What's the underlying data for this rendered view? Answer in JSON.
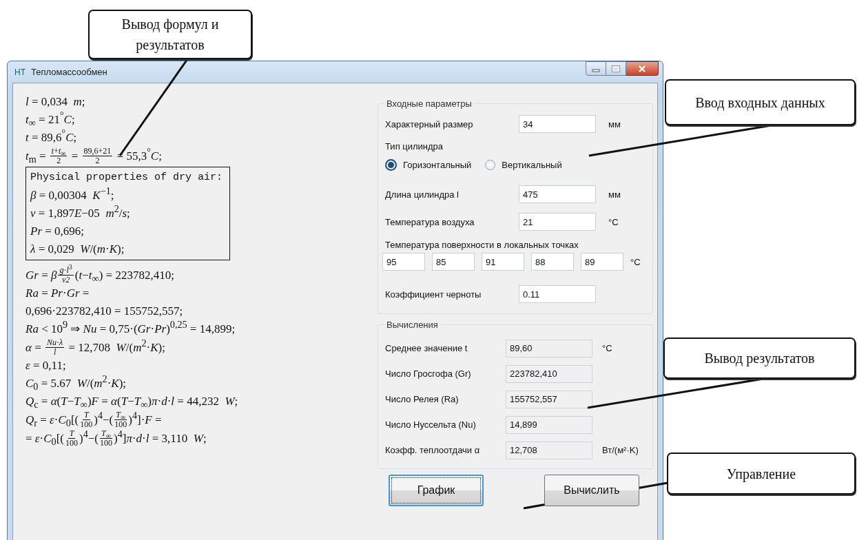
{
  "window": {
    "icon_text": "НТ",
    "title": "Тепломассообмен"
  },
  "formulas": {
    "lines_before": [
      {
        "parts": [
          {
            "kind": "text",
            "text": "*l* = 0,034  *m*;"
          }
        ]
      },
      {
        "parts": [
          {
            "kind": "text",
            "text": "*t*$_{∞}$ = 21$^{°}$*C*;"
          }
        ]
      },
      {
        "parts": [
          {
            "kind": "text",
            "text": "*t* = 89,6$^{°}$*C*;"
          }
        ]
      },
      {
        "parts": [
          {
            "kind": "text",
            "text": "*t*$_{m}$ = "
          },
          {
            "kind": "frac",
            "num": "*t*+*t*$_{∞}$",
            "den": "2"
          },
          {
            "kind": "text",
            "text": " = "
          },
          {
            "kind": "frac",
            "num": "89,6+21",
            "den": "2"
          },
          {
            "kind": "text",
            "text": " = 55,3$^{°}$*C*;"
          }
        ]
      }
    ],
    "properties_box": {
      "title": "Physical properties of dry air:",
      "lines": [
        {
          "parts": [
            {
              "kind": "text",
              "text": "*β* = 0,00304  *K*$^{−1}$;"
            }
          ]
        },
        {
          "parts": [
            {
              "kind": "text",
              "text": "*ν* = 1,897"
            },
            {
              "kind": "text",
              "text": "*E*−05  *m*$^{2}$/*s*;"
            }
          ]
        },
        {
          "parts": [
            {
              "kind": "text",
              "text": "*Pr* = 0,696;"
            }
          ]
        },
        {
          "parts": [
            {
              "kind": "text",
              "text": "*λ* = 0,029  *W*/(*m*·*K*);"
            }
          ]
        }
      ]
    },
    "lines_after": [
      {
        "parts": [
          {
            "kind": "text",
            "text": "*Gr* = *β*"
          },
          {
            "kind": "frac",
            "num": "*g*·*l*$^{3}$",
            "den": "*ν2*"
          },
          {
            "kind": "text",
            "text": "(*t*−*t*$_{∞}$) = 223782,410;"
          }
        ]
      },
      {
        "parts": [
          {
            "kind": "text",
            "text": "*Ra* = *Pr*·*Gr* ="
          }
        ]
      },
      {
        "parts": [
          {
            "kind": "text",
            "text": "0,696·223782,410 = 155752,557;"
          }
        ]
      },
      {
        "parts": [
          {
            "kind": "text",
            "text": "*Ra* < 10$^{9}$ ⇒ *Nu* = 0,75·(*Gr*·*Pr*)$^{0,25}$ = 14,899;"
          }
        ]
      },
      {
        "parts": [
          {
            "kind": "text",
            "text": "*α* = "
          },
          {
            "kind": "frac",
            "num": "*Nu*·*λ*",
            "den": "*l*"
          },
          {
            "kind": "text",
            "text": " = 12,708  *W*/(*m*$^{2}$·*K*);"
          }
        ]
      },
      {
        "parts": [
          {
            "kind": "text",
            "text": "*ε* = 0,11;"
          }
        ]
      },
      {
        "parts": [
          {
            "kind": "text",
            "text": "*C*$_{0}$ = 5.67  *W*/(*m*$^{2}$·*K*);"
          }
        ]
      },
      {
        "parts": [
          {
            "kind": "text",
            "text": "*Q*$_{c}$ = *α*(*T*−*T*$_{∞}$)*F* = *α*(*T*−*T*$_{∞}$)*π*·*d*·*l* = 44,232  *W*;"
          }
        ]
      },
      {
        "parts": [
          {
            "kind": "text",
            "text": "*Q*$_{r}$ = *ε*·*C*$_{0}$[("
          },
          {
            "kind": "frac",
            "num": "*T*",
            "den": "100"
          },
          {
            "kind": "text",
            "text": ")$^{4}$−("
          },
          {
            "kind": "frac",
            "num": "*T*$_{∞}$",
            "den": "100"
          },
          {
            "kind": "text",
            "text": ")$^{4}$]·*F* ="
          }
        ]
      },
      {
        "parts": [
          {
            "kind": "text",
            "text": "= *ε*·*C*$_{0}$[("
          },
          {
            "kind": "frac",
            "num": "*T*",
            "den": "100"
          },
          {
            "kind": "text",
            "text": ")$^{4}$−("
          },
          {
            "kind": "frac",
            "num": "*T*$_{∞}$",
            "den": "100"
          },
          {
            "kind": "text",
            "text": ")$^{4}$]*π*·*d*·*l* = 3,110  *W*;"
          }
        ]
      }
    ]
  },
  "input_group": {
    "title": "Входные параметры",
    "rows": [
      {
        "kind": "field",
        "label": "Характерный размер",
        "value": "34",
        "unit": "мм"
      },
      {
        "kind": "heading",
        "label": "Тип цилиндра"
      },
      {
        "kind": "radio",
        "options": [
          {
            "label": "Горизонтальный",
            "selected": true
          },
          {
            "label": "Вертикальный",
            "selected": false
          }
        ]
      },
      {
        "kind": "field",
        "label": "Длина цилиндра l",
        "value": "475",
        "unit": "мм"
      },
      {
        "kind": "field",
        "label": "Температура воздуха",
        "value": "21",
        "unit": "°C"
      },
      {
        "kind": "multi",
        "label": "Температура поверхности в локальных точках",
        "values": [
          "95",
          "85",
          "91",
          "88",
          "89"
        ],
        "unit": "°C"
      },
      {
        "kind": "field",
        "label": "Коэффициент черноты",
        "value": "0.11"
      }
    ]
  },
  "results_group": {
    "title": "Вычисления",
    "rows": [
      {
        "label": "Среднее значение t",
        "value": "89,60",
        "unit": "°C"
      },
      {
        "label": "Число Гросгофа (Gr)",
        "value": "223782,410"
      },
      {
        "label": "Число Релея (Ra)",
        "value": "155752,557"
      },
      {
        "label": "Число Нуссельта (Nu)",
        "value": "14,899"
      },
      {
        "label": "Коэфф. теплоотдачи α",
        "value": "12,708",
        "unit": "Вт/(м²·K)"
      }
    ]
  },
  "buttons": [
    {
      "label": "График",
      "focused": true
    },
    {
      "label": "Вычислить",
      "focused": false
    }
  ],
  "callouts": [
    {
      "text": "Вывод формул и результатов"
    },
    {
      "text": "Ввод входных данных"
    },
    {
      "text": "Вывод результатов"
    },
    {
      "text": "Управление"
    }
  ]
}
